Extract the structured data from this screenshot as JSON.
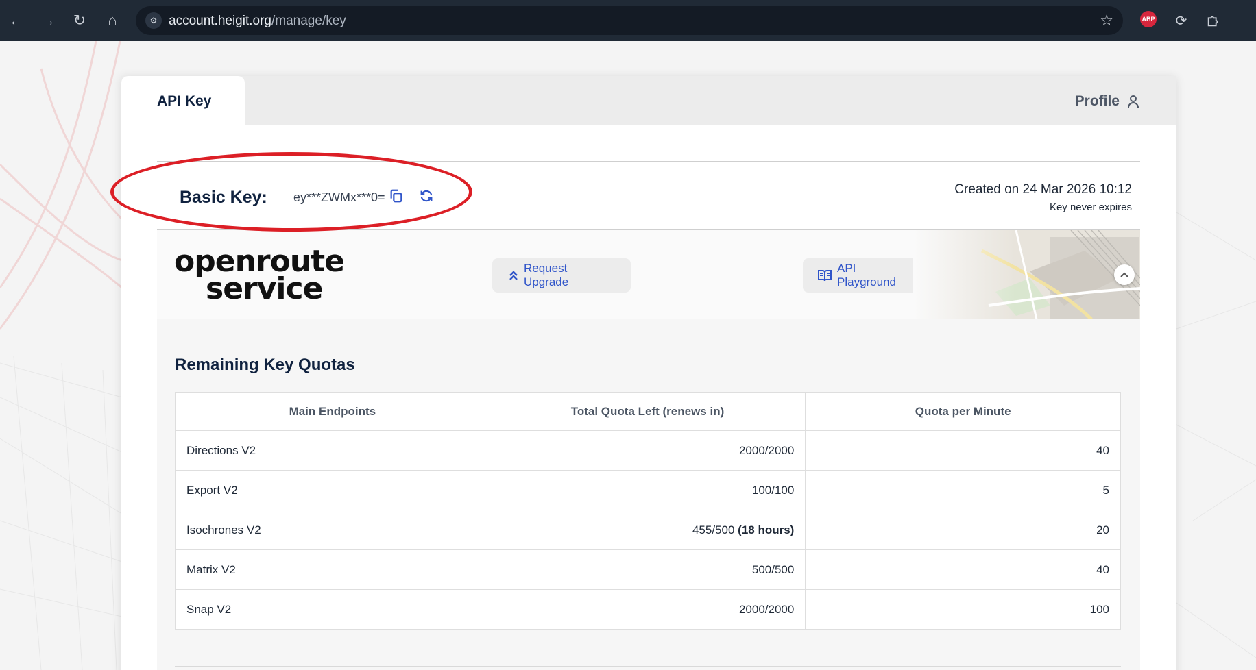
{
  "browser": {
    "url_host": "account.heigit.org",
    "url_path": "/manage/key",
    "extensions": [
      "adblock-plus-icon",
      "sync-icon",
      "puzzle-icon"
    ],
    "abp_label": "ABP"
  },
  "tabs": {
    "active": "API Key",
    "profile": "Profile"
  },
  "key": {
    "label": "Basic Key:",
    "value": "ey***ZWMx***0=",
    "created": "Created on 24 Mar 2026 10:12",
    "expiry": "Key never expires"
  },
  "brand": {
    "logo_line1": "openroute",
    "logo_line2": "service",
    "upgrade_label": "Request Upgrade",
    "playground_label": "API Playground"
  },
  "quotas": {
    "title": "Remaining Key Quotas",
    "headers": [
      "Main Endpoints",
      "Total Quota Left (renews in)",
      "Quota per Minute"
    ],
    "rows": [
      {
        "endpoint": "Directions V2",
        "total": "2000/2000",
        "renews": "",
        "per_minute": "40"
      },
      {
        "endpoint": "Export V2",
        "total": "100/100",
        "renews": "",
        "per_minute": "5"
      },
      {
        "endpoint": "Isochrones V2",
        "total": "455/500",
        "renews": "(18 hours)",
        "per_minute": "20"
      },
      {
        "endpoint": "Matrix V2",
        "total": "500/500",
        "renews": "",
        "per_minute": "40"
      },
      {
        "endpoint": "Snap V2",
        "total": "2000/2000",
        "renews": "",
        "per_minute": "100"
      }
    ]
  },
  "colors": {
    "accent": "#2f54c9",
    "highlight": "#dc1f26",
    "heading": "#10223f"
  }
}
